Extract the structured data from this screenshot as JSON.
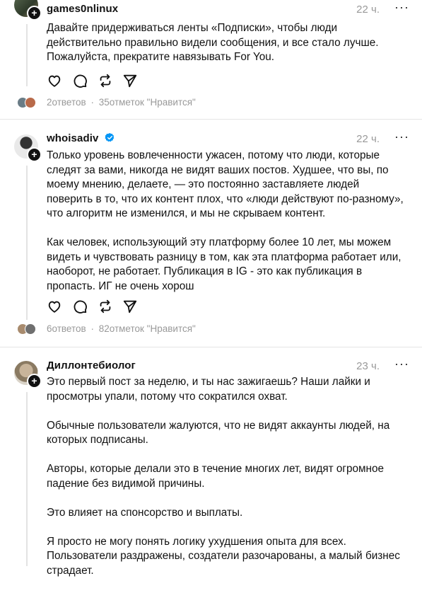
{
  "posts": [
    {
      "username": "games0nlinux",
      "time": "22 ч.",
      "more": "···",
      "paragraphs": [
        "Давайте придерживаться ленты «Подписки», чтобы люди действительно правильно видели сообщения, и все стало лучше. Пожалуйста, прекратите навязывать For You."
      ],
      "stats": {
        "replies": "2ответов",
        "separator": "·",
        "likes": "35отметок \"Нравится\""
      }
    },
    {
      "username": "whoisadiv",
      "time": "22 ч.",
      "more": "···",
      "paragraphs": [
        "Только уровень вовлеченности ужасен, потому что люди, которые следят за вами, никогда не видят ваших постов. Худшее, что вы, по моему мнению, делаете, — это постоянно заставляете людей поверить в то, что их контент плох, что «люди действуют по-разному», что алгоритм не изменился, и мы не скрываем контент.",
        "Как человек, использующий эту платформу более 10 лет, мы можем видеть и чувствовать разницу в том, как эта платформа работает или, наоборот, не работает. Публикация в IG - это как публикация в пропасть. ИГ не очень хорош"
      ],
      "stats": {
        "replies": "6ответов",
        "separator": "·",
        "likes": "82отметок \"Нравится\""
      }
    },
    {
      "username": "Диллонтебиолог",
      "time": "23 ч.",
      "more": "···",
      "paragraphs": [
        "Это первый пост за неделю, и ты нас зажигаешь? Наши лайки и просмотры упали, потому что сократился охват.",
        "Обычные пользователи жалуются, что не видят аккаунты людей, на которых подписаны.",
        "Авторы, которые делали это в течение многих лет, видят огромное падение без видимой причины.",
        "Это влияет на спонсорство и выплаты.",
        "Я просто не могу понять логику ухудшения опыта для всех. Пользователи раздражены, создатели разочарованы, а малый бизнес страдает."
      ]
    }
  ],
  "icons": {
    "follow": "plus-icon",
    "like": "heart-icon",
    "reply": "comment-icon",
    "repost": "repost-icon",
    "share": "send-icon",
    "verified": "verified-badge-icon"
  },
  "colors": {
    "text": "#111111",
    "muted": "#999999",
    "verified": "#0095f6",
    "divider": "#e5e5e5"
  }
}
